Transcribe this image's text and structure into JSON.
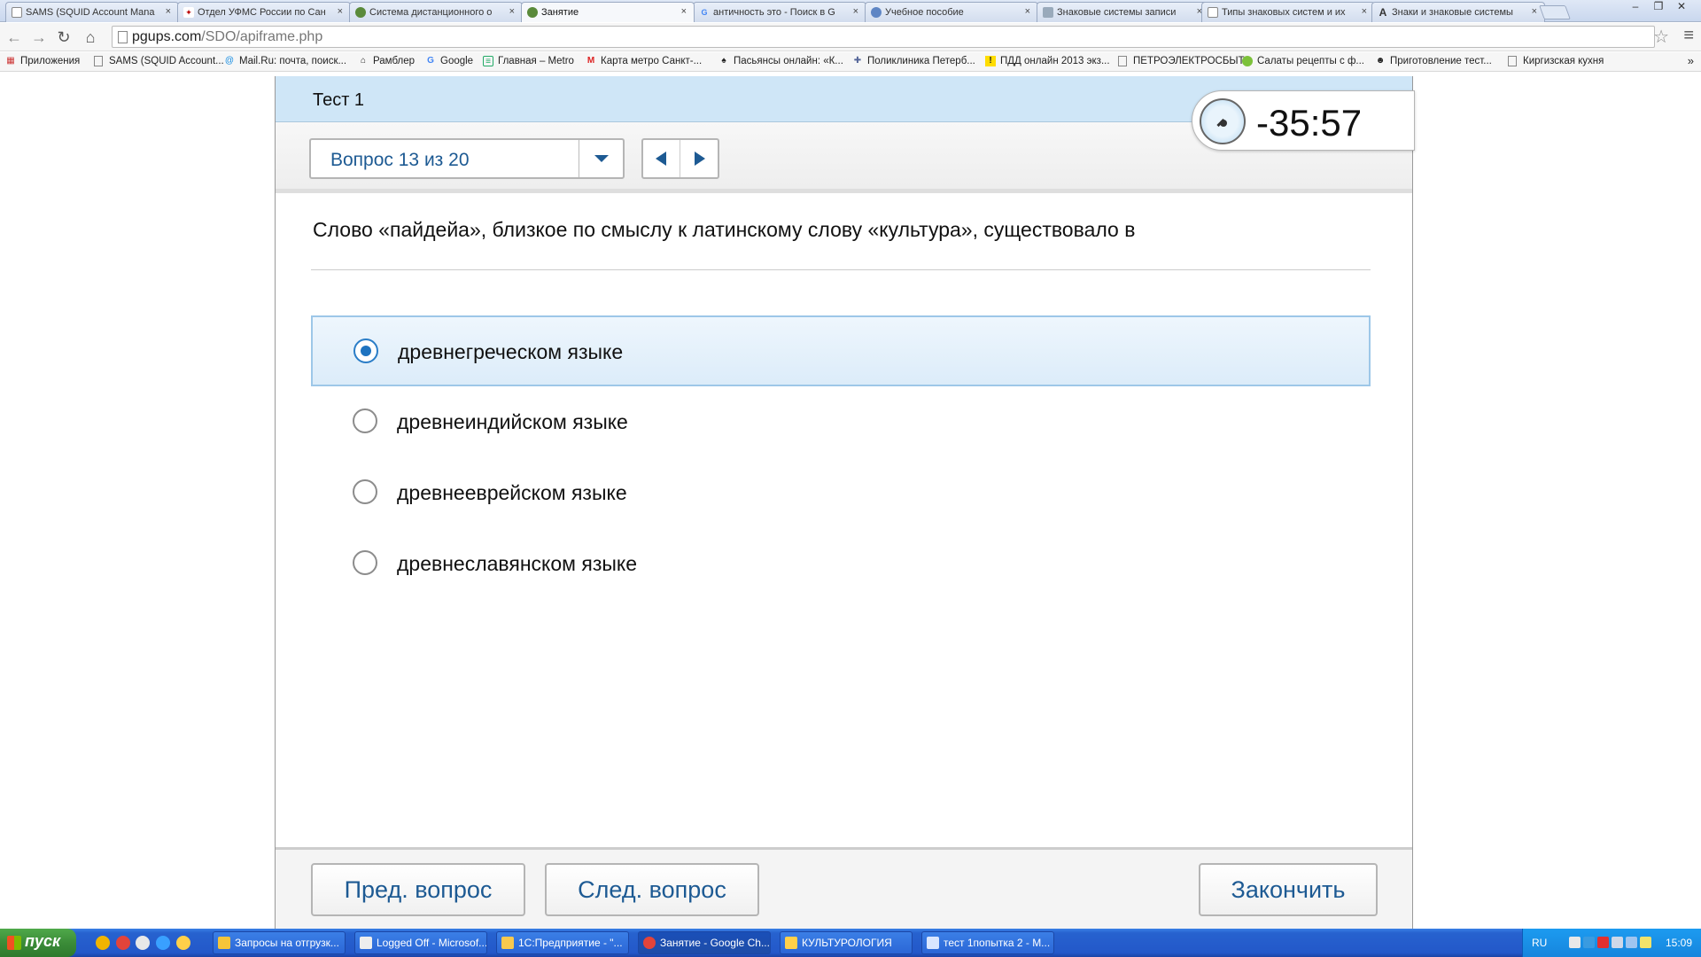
{
  "browser": {
    "tabs": [
      {
        "label": "SAMS (SQUID Account Mana",
        "icon": "page-icon"
      },
      {
        "label": "Отдел УФМС России по Сан",
        "icon": "emblem-icon"
      },
      {
        "label": "Система дистанционного о",
        "icon": "moodle-icon"
      },
      {
        "label": "Занятие",
        "icon": "moodle-icon",
        "active": true
      },
      {
        "label": "античность это - Поиск в G",
        "icon": "google-icon"
      },
      {
        "label": "Учебное пособие",
        "icon": "globe-icon"
      },
      {
        "label": "Знаковые системы записи",
        "icon": "page-icon"
      },
      {
        "label": "Типы знаковых систем и их",
        "icon": "page-icon"
      },
      {
        "label": "Знаки и знаковые системы",
        "icon": "letter-a-icon"
      }
    ],
    "close_glyph": "×",
    "window_buttons": [
      "–",
      "❐",
      "✕"
    ],
    "url_host": "pgups.com",
    "url_path": "/SDO/apiframe.php",
    "star_glyph": "☆",
    "menu_glyph": "≡"
  },
  "bookmarks": [
    "Приложения",
    "SAMS (SQUID Account...",
    "Mail.Ru: почта, поиск...",
    "Рамблер",
    "Google",
    "Главная – Metro",
    "Карта метро Санкт-...",
    "Пасьянсы онлайн: «К...",
    "Поликлиника Петерб...",
    "ПДД онлайн 2013 экз...",
    "ПЕТРОЭЛЕКТРОСБЫТ",
    "Салаты рецепты с ф...",
    "Приготовление тест...",
    "Киргизская кухня"
  ],
  "bookmarks_more": "»",
  "test": {
    "title": "Тест 1",
    "question_selector": "Вопрос 13 из 20",
    "timer": "-35:57",
    "question_text": "Слово «пайдейа», близкое по смыслу к латинскому слову «культура», существовало в",
    "answers": [
      {
        "text": "древнегреческом языке",
        "selected": true
      },
      {
        "text": "древнеиндийском языке",
        "selected": false
      },
      {
        "text": "древнееврейском языке",
        "selected": false
      },
      {
        "text": "древнеславянском языке",
        "selected": false
      }
    ],
    "prev_button": "Пред. вопрос",
    "next_button": "След. вопрос",
    "finish_button": "Закончить"
  },
  "taskbar": {
    "start_label": "пуск",
    "tasks": [
      {
        "label": "Запросы на отгрузк...",
        "active": false
      },
      {
        "label": "Logged Off - Microsof...",
        "active": false
      },
      {
        "label": "1С:Предприятие - \"...",
        "active": false
      },
      {
        "label": "Занятие - Google Ch...",
        "active": true
      },
      {
        "label": "КУЛЬТУРОЛОГИЯ",
        "active": false
      },
      {
        "label": "тест 1попытка 2 - М...",
        "active": false
      }
    ],
    "language": "RU",
    "clock": "15:09"
  },
  "colors": {
    "accent": "#1d5a93",
    "header_bg": "#cfe6f7",
    "selected_bg": "#e4f0fb",
    "radio_selected": "#1e73c0",
    "taskbar": "#2358c9",
    "start_green": "#3b8c38"
  }
}
